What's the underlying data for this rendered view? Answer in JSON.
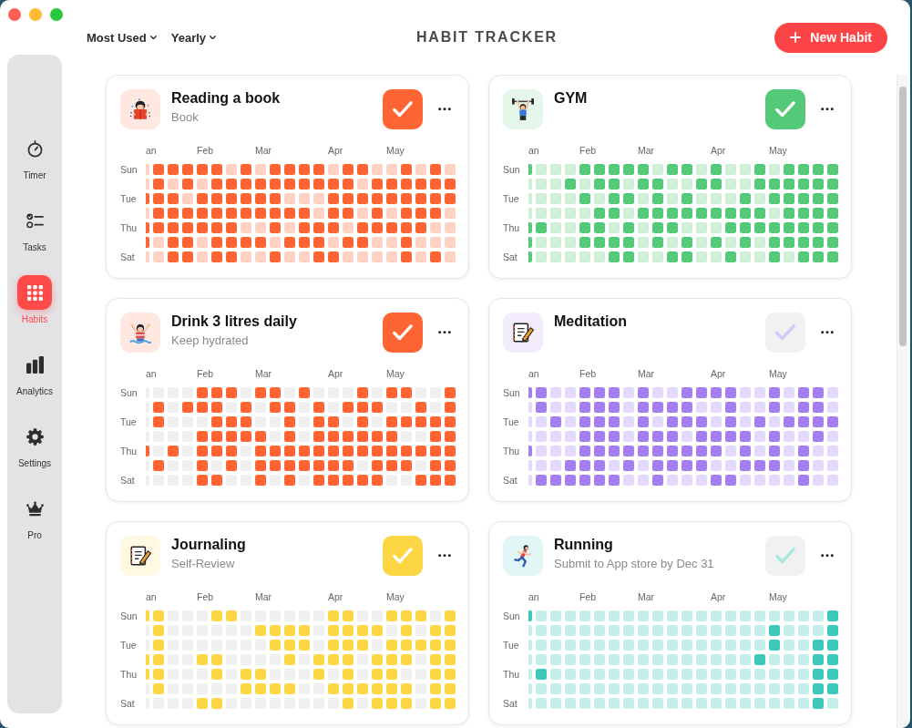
{
  "toolbar": {
    "sort": "Most Used",
    "period": "Yearly",
    "title": "HABIT TRACKER",
    "new_button": "New Habit"
  },
  "sidebar": {
    "items": [
      {
        "label": "Timer",
        "selected": false
      },
      {
        "label": "Tasks",
        "selected": false
      },
      {
        "label": "Habits",
        "selected": true
      },
      {
        "label": "Analytics",
        "selected": false
      },
      {
        "label": "Settings",
        "selected": false
      },
      {
        "label": "Pro",
        "selected": false
      }
    ]
  },
  "cards": [
    {
      "title": "Reading a book",
      "subtitle": "Book",
      "checked": true,
      "color": "#ff6533",
      "kind": "tinted",
      "day_labels": [
        "Sun",
        "Tue",
        "Thu",
        "Sat"
      ],
      "weeks": [
        {
          "month": "an",
          "days": [
            false,
            false,
            true,
            false,
            true,
            true,
            false
          ]
        },
        {
          "days": [
            true,
            true,
            true,
            true,
            true,
            false,
            false
          ]
        },
        {
          "days": [
            true,
            false,
            true,
            true,
            true,
            true,
            true
          ]
        },
        {
          "days": [
            true,
            true,
            false,
            true,
            true,
            true,
            true
          ]
        },
        {
          "month": "Feb",
          "days": [
            true,
            false,
            true,
            true,
            true,
            false,
            false
          ]
        },
        {
          "days": [
            true,
            true,
            true,
            true,
            true,
            true,
            true
          ]
        },
        {
          "days": [
            false,
            true,
            true,
            true,
            true,
            true,
            true
          ]
        },
        {
          "days": [
            true,
            true,
            true,
            true,
            false,
            true,
            false
          ]
        },
        {
          "month": "Mar",
          "days": [
            false,
            true,
            true,
            true,
            false,
            true,
            false
          ]
        },
        {
          "days": [
            true,
            true,
            true,
            true,
            true,
            false,
            true
          ]
        },
        {
          "days": [
            true,
            true,
            false,
            true,
            false,
            true,
            false
          ]
        },
        {
          "days": [
            true,
            true,
            false,
            true,
            true,
            true,
            false
          ]
        },
        {
          "days": [
            true,
            true,
            false,
            false,
            true,
            true,
            true
          ]
        },
        {
          "month": "Apr",
          "days": [
            false,
            true,
            true,
            true,
            true,
            false,
            true
          ]
        },
        {
          "days": [
            true,
            true,
            true,
            true,
            false,
            true,
            false
          ]
        },
        {
          "days": [
            true,
            false,
            true,
            false,
            true,
            true,
            false
          ]
        },
        {
          "days": [
            false,
            true,
            true,
            true,
            true,
            false,
            false
          ]
        },
        {
          "month": "May",
          "days": [
            false,
            true,
            true,
            false,
            true,
            false,
            false
          ]
        },
        {
          "days": [
            true,
            true,
            true,
            true,
            true,
            true,
            true
          ]
        },
        {
          "days": [
            false,
            true,
            true,
            true,
            true,
            false,
            false
          ]
        },
        {
          "days": [
            true,
            true,
            true,
            true,
            false,
            false,
            true
          ]
        },
        {
          "days": [
            false,
            true,
            true,
            false,
            false,
            false,
            false
          ]
        }
      ]
    },
    {
      "title": "GYM",
      "checked": true,
      "color": "#54c977",
      "kind": "tinted",
      "day_labels": [
        "Sun",
        "Tue",
        "Thu",
        "Sat"
      ],
      "weeks": [
        {
          "month": "an",
          "days": [
            true,
            false,
            false,
            false,
            true,
            true,
            true
          ]
        },
        {
          "days": [
            false,
            false,
            false,
            false,
            true,
            false,
            false
          ]
        },
        {
          "days": [
            false,
            false,
            false,
            false,
            false,
            false,
            false
          ]
        },
        {
          "days": [
            false,
            true,
            false,
            false,
            false,
            false,
            false
          ]
        },
        {
          "month": "Feb",
          "days": [
            true,
            false,
            true,
            false,
            true,
            true,
            false
          ]
        },
        {
          "days": [
            true,
            true,
            false,
            true,
            true,
            true,
            false
          ]
        },
        {
          "days": [
            true,
            true,
            true,
            true,
            false,
            true,
            true
          ]
        },
        {
          "days": [
            true,
            false,
            true,
            false,
            true,
            true,
            true
          ]
        },
        {
          "month": "Mar",
          "days": [
            true,
            true,
            false,
            true,
            false,
            false,
            false
          ]
        },
        {
          "days": [
            false,
            true,
            true,
            true,
            true,
            true,
            false
          ]
        },
        {
          "days": [
            true,
            false,
            false,
            true,
            true,
            false,
            true
          ]
        },
        {
          "days": [
            true,
            false,
            true,
            true,
            false,
            true,
            true
          ]
        },
        {
          "days": [
            false,
            true,
            false,
            true,
            false,
            false,
            false
          ]
        },
        {
          "month": "Apr",
          "days": [
            true,
            true,
            false,
            true,
            false,
            true,
            false
          ]
        },
        {
          "days": [
            false,
            false,
            false,
            true,
            true,
            false,
            true
          ]
        },
        {
          "days": [
            false,
            false,
            true,
            true,
            true,
            true,
            false
          ]
        },
        {
          "days": [
            true,
            true,
            false,
            true,
            true,
            false,
            false
          ]
        },
        {
          "month": "May",
          "days": [
            false,
            true,
            true,
            false,
            true,
            true,
            true
          ]
        },
        {
          "days": [
            true,
            true,
            true,
            true,
            true,
            true,
            false
          ]
        },
        {
          "days": [
            true,
            true,
            true,
            true,
            true,
            true,
            true
          ]
        },
        {
          "days": [
            true,
            true,
            true,
            true,
            true,
            true,
            true
          ]
        },
        {
          "days": [
            true,
            true,
            true,
            true,
            true,
            true,
            true
          ]
        }
      ]
    },
    {
      "title": "Drink 3 litres daily",
      "subtitle": "Keep hydrated",
      "checked": true,
      "color": "#ff6533",
      "kind": "plain",
      "day_labels": [
        "Sun",
        "Tue",
        "Thu",
        "Sat"
      ],
      "weeks": [
        {
          "month": "an",
          "days": [
            false,
            false,
            false,
            false,
            true,
            false,
            false
          ]
        },
        {
          "days": [
            false,
            true,
            true,
            false,
            false,
            true,
            false
          ]
        },
        {
          "days": [
            false,
            false,
            false,
            false,
            true,
            false,
            false
          ]
        },
        {
          "days": [
            false,
            true,
            false,
            false,
            false,
            false,
            false
          ]
        },
        {
          "month": "Feb",
          "days": [
            true,
            true,
            false,
            true,
            true,
            true,
            true
          ]
        },
        {
          "days": [
            true,
            true,
            true,
            true,
            true,
            false,
            true
          ]
        },
        {
          "days": [
            true,
            false,
            true,
            true,
            true,
            true,
            false
          ]
        },
        {
          "days": [
            false,
            true,
            true,
            true,
            false,
            false,
            false
          ]
        },
        {
          "month": "Mar",
          "days": [
            true,
            false,
            false,
            true,
            true,
            true,
            true
          ]
        },
        {
          "days": [
            true,
            true,
            false,
            false,
            true,
            true,
            false
          ]
        },
        {
          "days": [
            false,
            true,
            true,
            true,
            true,
            true,
            true
          ]
        },
        {
          "days": [
            true,
            false,
            false,
            false,
            true,
            true,
            false
          ]
        },
        {
          "days": [
            false,
            true,
            true,
            true,
            true,
            true,
            true
          ]
        },
        {
          "month": "Apr",
          "days": [
            false,
            false,
            true,
            true,
            true,
            true,
            true
          ]
        },
        {
          "days": [
            false,
            true,
            false,
            true,
            true,
            true,
            true
          ]
        },
        {
          "days": [
            true,
            true,
            true,
            true,
            true,
            false,
            true
          ]
        },
        {
          "days": [
            false,
            true,
            false,
            true,
            true,
            true,
            true
          ]
        },
        {
          "month": "May",
          "days": [
            true,
            false,
            true,
            true,
            true,
            true,
            false
          ]
        },
        {
          "days": [
            true,
            false,
            true,
            false,
            true,
            true,
            false
          ]
        },
        {
          "days": [
            false,
            true,
            true,
            false,
            true,
            false,
            true
          ]
        },
        {
          "days": [
            false,
            false,
            true,
            true,
            true,
            true,
            true
          ]
        },
        {
          "days": [
            true,
            true,
            true,
            true,
            true,
            true,
            true
          ]
        }
      ]
    },
    {
      "title": "Meditation",
      "checked": false,
      "color": "#a57ff0",
      "kind": "tinted",
      "day_labels": [
        "Sun",
        "Tue",
        "Thu",
        "Sat"
      ],
      "weeks": [
        {
          "month": "an",
          "days": [
            true,
            false,
            false,
            false,
            true,
            false,
            false
          ]
        },
        {
          "days": [
            true,
            true,
            false,
            false,
            false,
            false,
            true
          ]
        },
        {
          "days": [
            false,
            false,
            true,
            false,
            false,
            false,
            true
          ]
        },
        {
          "days": [
            false,
            false,
            false,
            false,
            false,
            true,
            true
          ]
        },
        {
          "month": "Feb",
          "days": [
            true,
            true,
            true,
            true,
            true,
            true,
            true
          ]
        },
        {
          "days": [
            true,
            true,
            true,
            true,
            true,
            true,
            true
          ]
        },
        {
          "days": [
            true,
            true,
            true,
            true,
            true,
            false,
            true
          ]
        },
        {
          "days": [
            false,
            false,
            false,
            false,
            true,
            true,
            false
          ]
        },
        {
          "month": "Mar",
          "days": [
            true,
            true,
            true,
            true,
            true,
            false,
            false
          ]
        },
        {
          "days": [
            false,
            true,
            false,
            true,
            true,
            true,
            true
          ]
        },
        {
          "days": [
            false,
            true,
            true,
            true,
            true,
            true,
            false
          ]
        },
        {
          "days": [
            true,
            true,
            true,
            false,
            true,
            true,
            false
          ]
        },
        {
          "days": [
            true,
            false,
            true,
            true,
            true,
            true,
            false
          ]
        },
        {
          "month": "Apr",
          "days": [
            true,
            false,
            false,
            true,
            true,
            false,
            true
          ]
        },
        {
          "days": [
            true,
            true,
            true,
            true,
            false,
            false,
            true
          ]
        },
        {
          "days": [
            false,
            false,
            false,
            true,
            true,
            true,
            false
          ]
        },
        {
          "days": [
            false,
            false,
            true,
            false,
            false,
            true,
            false
          ]
        },
        {
          "month": "May",
          "days": [
            true,
            true,
            false,
            true,
            true,
            true,
            false
          ]
        },
        {
          "days": [
            false,
            false,
            true,
            false,
            false,
            false,
            false
          ]
        },
        {
          "days": [
            true,
            true,
            true,
            false,
            true,
            true,
            true
          ]
        },
        {
          "days": [
            true,
            true,
            true,
            true,
            false,
            false,
            false
          ]
        },
        {
          "days": [
            false,
            false,
            true,
            false,
            false,
            false,
            false
          ]
        }
      ]
    },
    {
      "title": "Journaling",
      "subtitle": "Self-Review",
      "checked": true,
      "color": "#fdd645",
      "kind": "plain",
      "day_labels": [
        "Sun",
        "Tue",
        "Thu",
        "Sat"
      ],
      "weeks": [
        {
          "month": "an",
          "days": [
            true,
            false,
            false,
            true,
            true,
            false,
            false
          ]
        },
        {
          "days": [
            true,
            true,
            true,
            true,
            true,
            true,
            false
          ]
        },
        {
          "days": [
            false,
            false,
            false,
            false,
            false,
            false,
            false
          ]
        },
        {
          "days": [
            false,
            false,
            false,
            false,
            false,
            false,
            false
          ]
        },
        {
          "month": "Feb",
          "days": [
            false,
            false,
            false,
            true,
            false,
            false,
            true
          ]
        },
        {
          "days": [
            true,
            false,
            false,
            true,
            true,
            false,
            true
          ]
        },
        {
          "days": [
            true,
            false,
            false,
            false,
            false,
            false,
            false
          ]
        },
        {
          "days": [
            false,
            false,
            false,
            false,
            true,
            true,
            false
          ]
        },
        {
          "month": "Mar",
          "days": [
            false,
            true,
            false,
            false,
            true,
            true,
            false
          ]
        },
        {
          "days": [
            false,
            true,
            true,
            false,
            false,
            true,
            false
          ]
        },
        {
          "days": [
            false,
            true,
            true,
            true,
            false,
            true,
            false
          ]
        },
        {
          "days": [
            false,
            true,
            true,
            false,
            false,
            false,
            false
          ]
        },
        {
          "days": [
            false,
            false,
            false,
            true,
            true,
            false,
            false
          ]
        },
        {
          "month": "Apr",
          "days": [
            true,
            true,
            true,
            true,
            false,
            true,
            false
          ]
        },
        {
          "days": [
            true,
            true,
            true,
            true,
            true,
            true,
            true
          ]
        },
        {
          "days": [
            false,
            true,
            true,
            false,
            false,
            true,
            false
          ]
        },
        {
          "days": [
            false,
            true,
            false,
            true,
            true,
            true,
            true
          ]
        },
        {
          "month": "May",
          "days": [
            true,
            false,
            true,
            true,
            true,
            true,
            true
          ]
        },
        {
          "days": [
            true,
            true,
            true,
            true,
            false,
            true,
            true
          ]
        },
        {
          "days": [
            true,
            false,
            true,
            false,
            false,
            false,
            false
          ]
        },
        {
          "days": [
            false,
            true,
            true,
            true,
            true,
            true,
            true
          ]
        },
        {
          "days": [
            true,
            true,
            true,
            true,
            true,
            true,
            true
          ]
        }
      ]
    },
    {
      "title": "Running",
      "subtitle": "Submit to App store by Dec 31",
      "checked": false,
      "color": "#3dc8bc",
      "kind": "tinted",
      "day_labels": [
        "Sun",
        "Tue",
        "Thu",
        "Sat"
      ],
      "weeks": [
        {
          "month": "an",
          "days": [
            true,
            false,
            false,
            false,
            false,
            false,
            false
          ]
        },
        {
          "days": [
            false,
            false,
            false,
            false,
            true,
            false,
            false
          ]
        },
        {
          "days": [
            false,
            false,
            false,
            false,
            false,
            false,
            false
          ]
        },
        {
          "days": [
            false,
            false,
            false,
            false,
            false,
            false,
            false
          ]
        },
        {
          "month": "Feb",
          "days": [
            false,
            false,
            false,
            false,
            false,
            false,
            false
          ]
        },
        {
          "days": [
            false,
            false,
            false,
            false,
            false,
            false,
            false
          ]
        },
        {
          "days": [
            false,
            false,
            false,
            false,
            false,
            false,
            false
          ]
        },
        {
          "days": [
            false,
            false,
            false,
            false,
            false,
            false,
            false
          ]
        },
        {
          "month": "Mar",
          "days": [
            false,
            false,
            false,
            false,
            false,
            false,
            false
          ]
        },
        {
          "days": [
            false,
            false,
            false,
            false,
            false,
            false,
            false
          ]
        },
        {
          "days": [
            false,
            false,
            false,
            false,
            false,
            false,
            false
          ]
        },
        {
          "days": [
            false,
            false,
            false,
            false,
            false,
            false,
            false
          ]
        },
        {
          "days": [
            false,
            false,
            false,
            false,
            false,
            false,
            false
          ]
        },
        {
          "month": "Apr",
          "days": [
            false,
            false,
            false,
            false,
            false,
            false,
            false
          ]
        },
        {
          "days": [
            false,
            false,
            false,
            false,
            false,
            false,
            false
          ]
        },
        {
          "days": [
            false,
            false,
            false,
            false,
            false,
            false,
            false
          ]
        },
        {
          "days": [
            false,
            false,
            false,
            true,
            false,
            false,
            false
          ]
        },
        {
          "month": "May",
          "days": [
            false,
            true,
            true,
            false,
            false,
            false,
            false
          ]
        },
        {
          "days": [
            false,
            false,
            false,
            false,
            false,
            false,
            false
          ]
        },
        {
          "days": [
            false,
            false,
            false,
            false,
            false,
            false,
            false
          ]
        },
        {
          "days": [
            false,
            false,
            true,
            true,
            true,
            true,
            true
          ]
        },
        {
          "days": [
            true,
            true,
            true,
            true,
            true,
            true,
            false
          ]
        }
      ]
    }
  ]
}
